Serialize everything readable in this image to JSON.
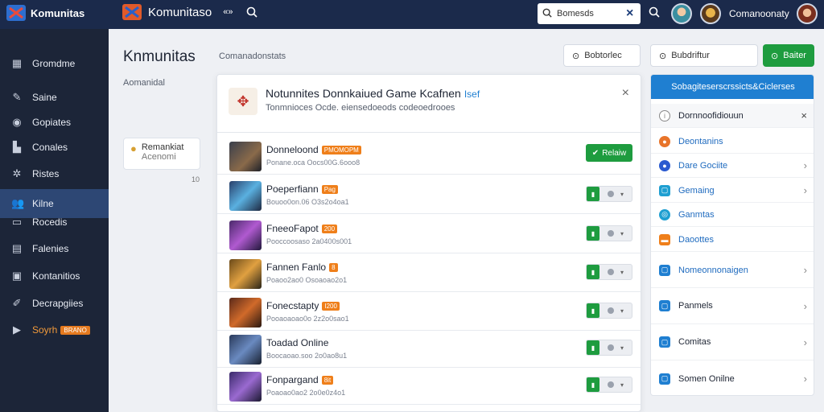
{
  "topbar": {
    "brand_left": "Komunitas",
    "brand_center": "Komunitaso",
    "search_value": "Bomesds",
    "user_name": "Comanoonaty"
  },
  "sidebar": {
    "items": [
      {
        "label": "Gromdme",
        "icon": "grid-icon"
      },
      {
        "label": "Saine",
        "icon": "pencil-icon"
      },
      {
        "label": "Gopiates",
        "icon": "circle-icon"
      },
      {
        "label": "Conales",
        "icon": "bar-chart-icon"
      },
      {
        "label": "Ristes",
        "icon": "gear-icon"
      },
      {
        "label": "Kilne",
        "icon": "users-icon"
      },
      {
        "label": "Rocedis",
        "icon": "comment-icon"
      },
      {
        "label": "Falenies",
        "icon": "document-icon"
      },
      {
        "label": "Kontanitios",
        "icon": "chat-icon"
      },
      {
        "label": "Decrapgiies",
        "icon": "wrench-icon"
      },
      {
        "label": "Soyrh",
        "icon": "play-icon",
        "badge": "BRANO"
      }
    ],
    "active_index": 5
  },
  "content": {
    "title": "Knmunitas",
    "subtitle": "Comanadonstats",
    "sub_label": "Aomanidal",
    "mini_card": {
      "line1": "Remankiat",
      "line2": "Acenomi"
    },
    "mini_count": "10",
    "btn_filter": "Bobtorlec",
    "btn_search": "Bubdriftur",
    "btn_add": "Baiter"
  },
  "dialog": {
    "title": "Notunnites Donnkaiued Game Kcafnen",
    "title_accent": "Isef",
    "subtitle": "Tonmnioces Ocde. eiensedoeods codeoedrooes",
    "close": "×",
    "rows": [
      {
        "name": "Donneloond",
        "tag": "PMOMOPM",
        "meta": "Ponane.oca Oocs00G.6ooo8",
        "button": "Relaiw"
      },
      {
        "name": "Poeperfiann",
        "tag": "Pag",
        "meta": "Bouoo0on.06 O3s2o4oa1"
      },
      {
        "name": "FneeoFapot",
        "tag": "200",
        "meta": "Pooccoosaso 2a0400s001"
      },
      {
        "name": "Fannen Fanlo",
        "tag": "8",
        "meta": "Poaoo2ao0 Osoaoao2o1"
      },
      {
        "name": "Fonecstapty",
        "tag": "I200",
        "meta": "Pooaoaoao0o 2z2o0sao1"
      },
      {
        "name": "Toadad Online",
        "tag": "",
        "meta": "Boocaoao.soo 2o0ao8u1"
      },
      {
        "name": "Fonpargand",
        "tag": "8it",
        "meta": "Poaoao0ao2 2o0e0z4o1"
      }
    ]
  },
  "right_panel": {
    "header": "Sobagiteserscrssicts&Ciclerses",
    "items": [
      {
        "label": "Dornnoofidiouun",
        "icon": "info-icon",
        "trail": "×"
      },
      {
        "label": "Deontanins",
        "icon": "firefox-icon",
        "trail": ""
      },
      {
        "label": "Dare Gociite",
        "icon": "chrome-icon",
        "trail": "›"
      },
      {
        "label": "Gemaing",
        "icon": "window-icon",
        "trail": "›"
      },
      {
        "label": "Ganmtas",
        "icon": "globe-icon",
        "trail": ""
      },
      {
        "label": "Daoottes",
        "icon": "folder-icon",
        "trail": ""
      },
      {
        "label": "Nomeonnonaigen",
        "icon": "window-icon",
        "trail": "›"
      },
      {
        "label": "Panmels",
        "icon": "window-icon",
        "trail": "›"
      },
      {
        "label": "Comitas",
        "icon": "window-icon",
        "trail": "›"
      },
      {
        "label": "Somen Onilne",
        "icon": "window-icon",
        "trail": "›"
      }
    ]
  },
  "colors": {
    "topbar": "#1b2a4b",
    "sidebar": "#1c2538",
    "sidebar_active": "#2d4774",
    "accent_blue": "#1f7fd1",
    "green": "#1e9c3f",
    "orange": "#ef7f1a"
  }
}
